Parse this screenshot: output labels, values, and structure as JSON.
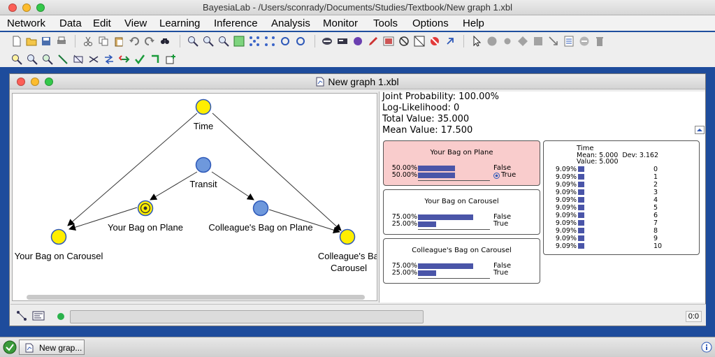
{
  "window": {
    "title": "BayesiaLab - /Users/sconrady/Documents/Studies/Textbook/New graph 1.xbl"
  },
  "menu": [
    "Network",
    "Data",
    "Edit",
    "View",
    "Learning",
    "Inference",
    "Analysis",
    "Monitor",
    "Tools",
    "Options",
    "Help"
  ],
  "inner_window": {
    "title": "New graph 1.xbl"
  },
  "graph": {
    "nodes": {
      "time": "Time",
      "transit": "Transit",
      "your_bag_plane": "Your Bag on Plane",
      "colleague_bag_plane": "Colleague's Bag on Plane",
      "your_bag_carousel": "Your Bag on Carousel",
      "colleague_bag_carousel_1": "Colleague's Bag",
      "colleague_bag_carousel_2": "Carousel"
    },
    "colors": {
      "yellow_node": "#ffee00",
      "blue_node": "#6e98dc"
    }
  },
  "stats": {
    "joint": "Joint Probability: 100.00%",
    "loglik": "Log-Likelihood: 0",
    "total": "Total Value: 35.000",
    "mean": "Mean Value: 17.500"
  },
  "monitors": {
    "plane": {
      "title": "Your Bag on Plane",
      "rows": [
        {
          "pct": "50.00%",
          "label": "False",
          "value": 0.5
        },
        {
          "pct": "50.00%",
          "label": "True",
          "value": 0.5
        }
      ],
      "highlight": "#f9cccc"
    },
    "carousel": {
      "title": "Your Bag on Carousel",
      "rows": [
        {
          "pct": "75.00%",
          "label": "False",
          "value": 0.75
        },
        {
          "pct": "25.00%",
          "label": "True",
          "value": 0.25
        }
      ]
    },
    "colleague": {
      "title": "Colleague's Bag on Carousel",
      "rows": [
        {
          "pct": "75.00%",
          "label": "False",
          "value": 0.75
        },
        {
          "pct": "25.00%",
          "label": "True",
          "value": 0.25
        }
      ]
    },
    "time": {
      "title": "Time",
      "mean_line": "Mean: 5.000  Dev: 3.162",
      "value_line": "Value: 5.000",
      "rows": [
        {
          "pct": "9.09%",
          "label": "0"
        },
        {
          "pct": "9.09%",
          "label": "1"
        },
        {
          "pct": "9.09%",
          "label": "2"
        },
        {
          "pct": "9.09%",
          "label": "3"
        },
        {
          "pct": "9.09%",
          "label": "4"
        },
        {
          "pct": "9.09%",
          "label": "5"
        },
        {
          "pct": "9.09%",
          "label": "6"
        },
        {
          "pct": "9.09%",
          "label": "7"
        },
        {
          "pct": "9.09%",
          "label": "8"
        },
        {
          "pct": "9.09%",
          "label": "9"
        },
        {
          "pct": "9.09%",
          "label": "10"
        }
      ],
      "value": 0.0909
    }
  },
  "statusbar": {
    "coords": "0:0"
  },
  "taskbar": {
    "item": "New grap..."
  }
}
